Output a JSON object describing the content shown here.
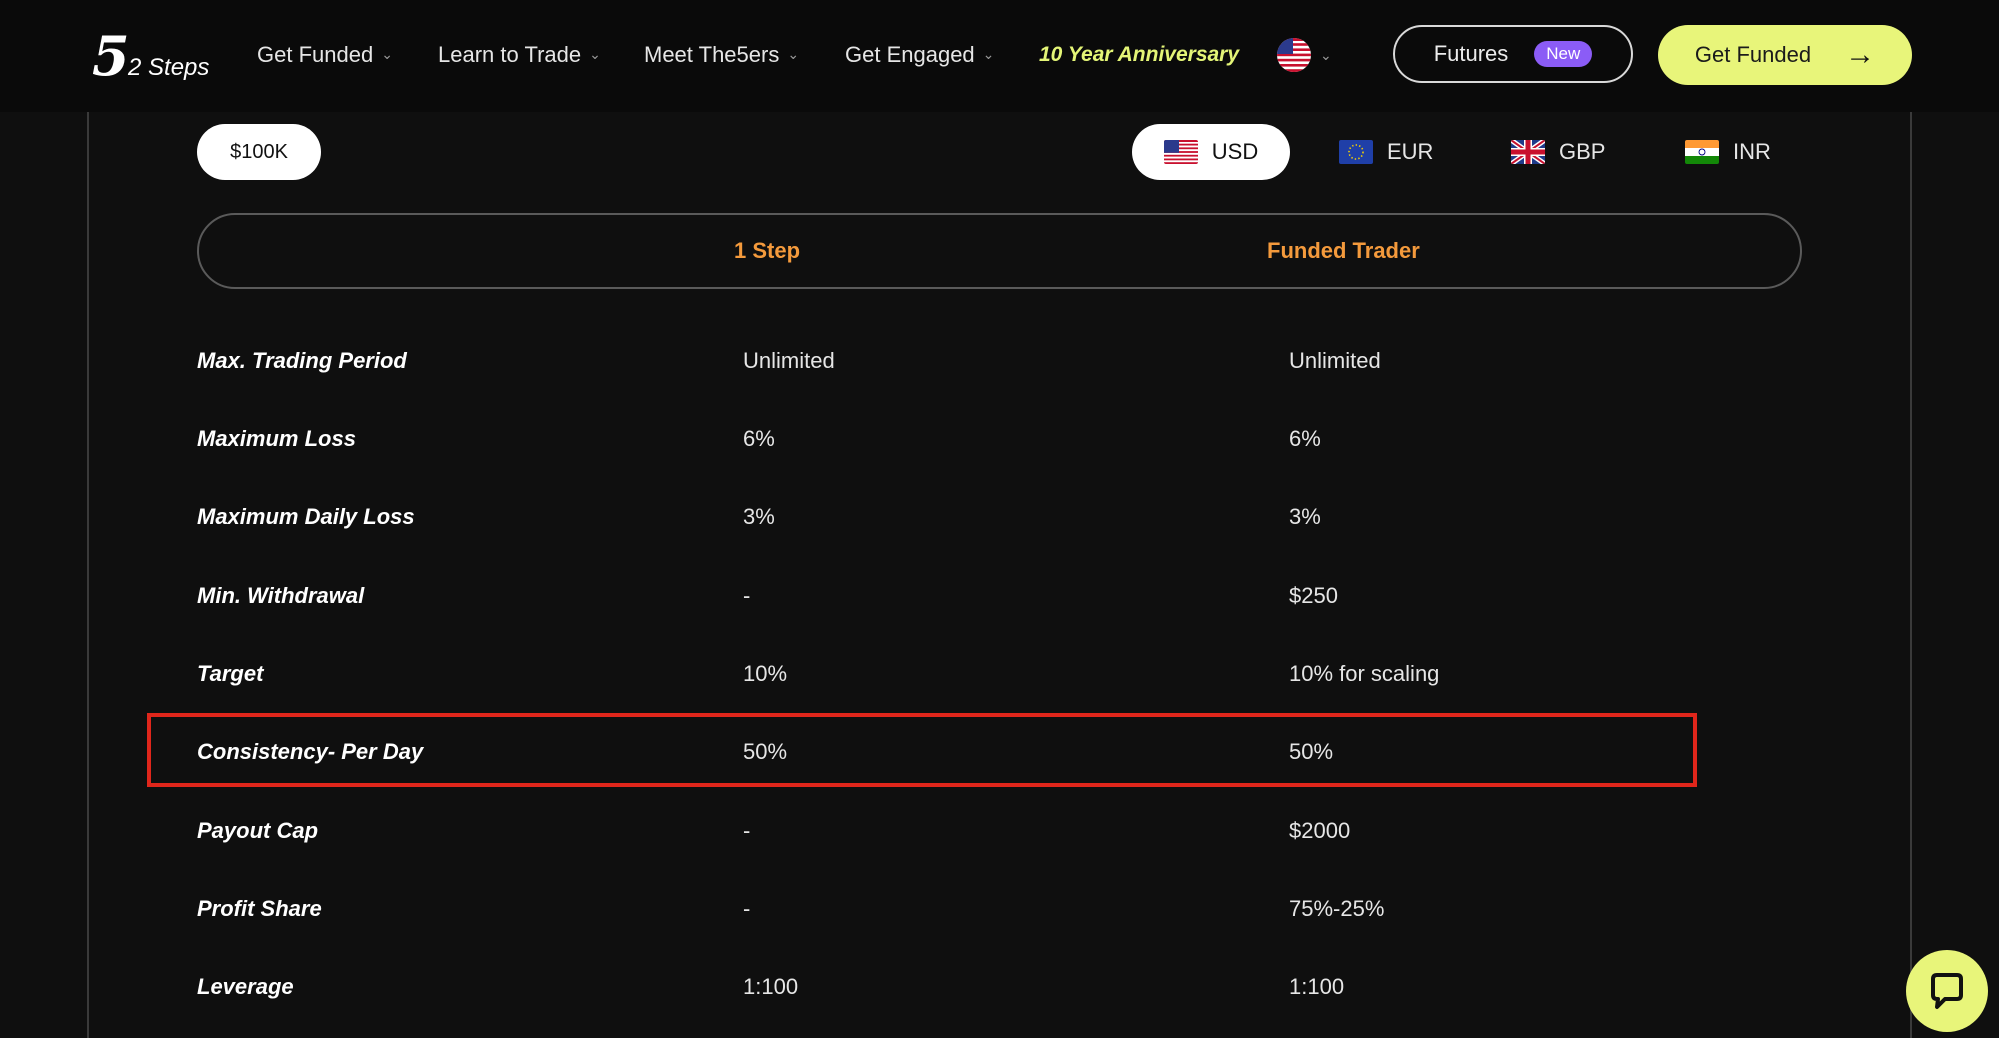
{
  "logo": {
    "mark": "5",
    "sub": "2 Steps"
  },
  "nav": {
    "items": [
      {
        "label": "Get Funded"
      },
      {
        "label": "Learn to Trade"
      },
      {
        "label": "Meet The5ers"
      },
      {
        "label": "Get Engaged"
      }
    ],
    "anniversary": "10 Year Anniversary",
    "futures_label": "Futures",
    "new_badge": "New",
    "cta_label": "Get Funded"
  },
  "account": {
    "amount": "$100K"
  },
  "currencies": [
    {
      "code": "USD",
      "selected": true
    },
    {
      "code": "EUR",
      "selected": false
    },
    {
      "code": "GBP",
      "selected": false
    },
    {
      "code": "INR",
      "selected": false
    }
  ],
  "plans": {
    "col1": "1 Step",
    "col2": "Funded Trader"
  },
  "table": {
    "rows": [
      {
        "label": "Max. Trading Period",
        "v1": "Unlimited",
        "v2": "Unlimited"
      },
      {
        "label": "Maximum Loss",
        "v1": "6%",
        "v2": "6%"
      },
      {
        "label": "Maximum Daily Loss",
        "v1": "3%",
        "v2": "3%"
      },
      {
        "label": "Min. Withdrawal",
        "v1": "-",
        "v2": "$250"
      },
      {
        "label": "Target",
        "v1": "10%",
        "v2": "10% for scaling"
      },
      {
        "label": "Consistency- Per Day",
        "v1": "50%",
        "v2": "50%"
      },
      {
        "label": "Payout Cap",
        "v1": "-",
        "v2": "$2000"
      },
      {
        "label": "Profit Share",
        "v1": "-",
        "v2": "75%-25%"
      },
      {
        "label": "Leverage",
        "v1": "1:100",
        "v2": "1:100"
      }
    ]
  },
  "colors": {
    "accent_lime": "#e8f57a",
    "plan_orange": "#f49a3c",
    "badge_purple": "#8b5cf6",
    "highlight_red": "#e0261b",
    "background": "#0f0f0f"
  },
  "icons": {
    "chevron": "chevron-down-icon",
    "arrow": "arrow-right-icon",
    "chat": "chat-bubble-icon",
    "language": "us-flag-icon"
  }
}
